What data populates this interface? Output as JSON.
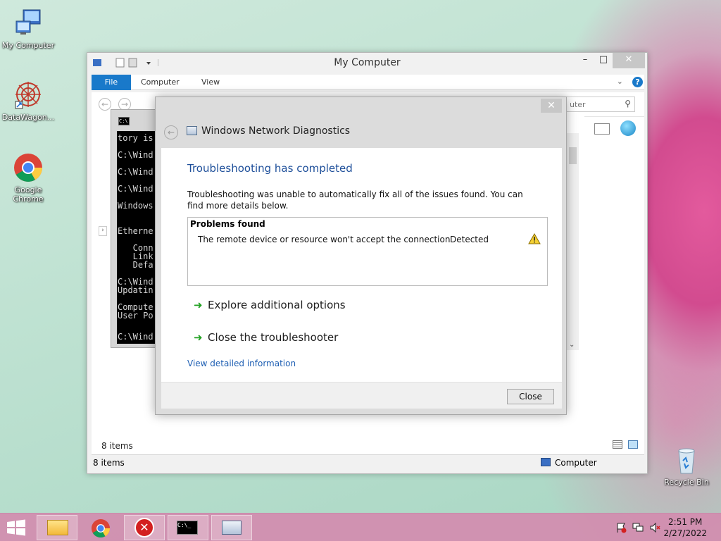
{
  "desktop": {
    "icons": [
      {
        "label": "My Computer"
      },
      {
        "label": "DataWagon..."
      },
      {
        "label": "Google Chrome"
      },
      {
        "label": "Recycle Bin"
      }
    ]
  },
  "explorer": {
    "title": "My Computer",
    "tabs": {
      "file": "File",
      "computer": "Computer",
      "view": "View"
    },
    "search_placeholder": "uter",
    "items_count_body": "8 items",
    "status_items": "8 items",
    "status_location": "Computer"
  },
  "console": {
    "lines": [
      "tory is",
      "C:\\Wind",
      "C:\\Wind",
      "C:\\Wind",
      "Windows",
      "Etherne",
      "   Conn",
      "   Link",
      "   Defa",
      "C:\\Wind",
      "Updatin",
      "Compute",
      "User Po",
      "C:\\Wind"
    ]
  },
  "diagnostics": {
    "title": "Windows Network Diagnostics",
    "heading": "Troubleshooting has completed",
    "description": "Troubleshooting was unable to automatically fix all of the issues found. You can find more details below.",
    "problems_title": "Problems found",
    "problem_text": "The remote device or resource won't accept the connection",
    "problem_status": "Detected",
    "action_explore": "Explore additional options",
    "action_close": "Close the troubleshooter",
    "detail_link": "View detailed information",
    "close_button": "Close"
  },
  "taskbar": {
    "time": "2:51 PM",
    "date": "2/27/2022"
  }
}
